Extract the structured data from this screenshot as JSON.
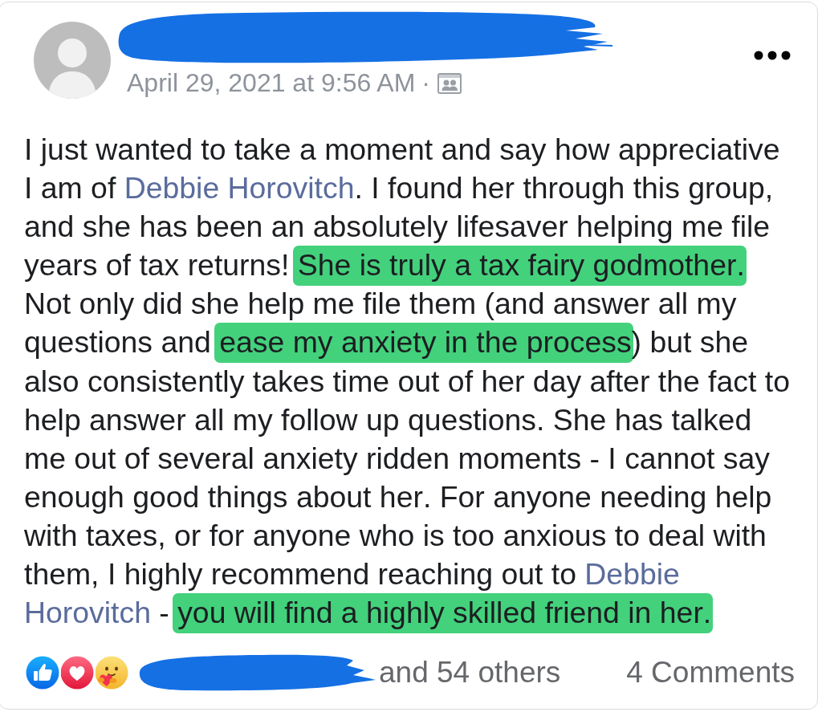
{
  "post": {
    "timestamp": "April 29, 2021 at 9:56 AM",
    "separator": "·",
    "body": [
      {
        "kind": "text",
        "text": "I just wanted to take a moment and say how appreciative I am of "
      },
      {
        "kind": "mention",
        "parts": [
          "Debbie Horovitch"
        ]
      },
      {
        "kind": "text",
        "text": ". I found her through this group, and she has been an absolutely lifesaver helping me file years of tax returns! "
      },
      {
        "kind": "highlight",
        "text": "She is truly a tax fairy godmother."
      },
      {
        "kind": "text",
        "text": " Not only did she help me file them (and answer all my questions and "
      },
      {
        "kind": "highlight",
        "text": "ease my anxiety in the process"
      },
      {
        "kind": "text",
        "text": ") but she also consistently takes time out of her day after the fact to help answer all my follow up questions. She has talked me out of several anxiety ridden moments - I cannot say enough good things about her. For anyone needing help with taxes, or for anyone who is too anxious to deal with them, I highly recommend reaching out to "
      },
      {
        "kind": "mention",
        "parts": [
          "Debbie",
          "Horovitch"
        ]
      },
      {
        "kind": "text",
        "text": " - "
      },
      {
        "kind": "highlight",
        "text": "you will find a highly skilled friend in her."
      }
    ],
    "reactions": [
      {
        "kind": "like"
      },
      {
        "kind": "love"
      },
      {
        "kind": "care"
      }
    ],
    "reaction_summary": "and 54 others",
    "comments": "4 Comments"
  }
}
